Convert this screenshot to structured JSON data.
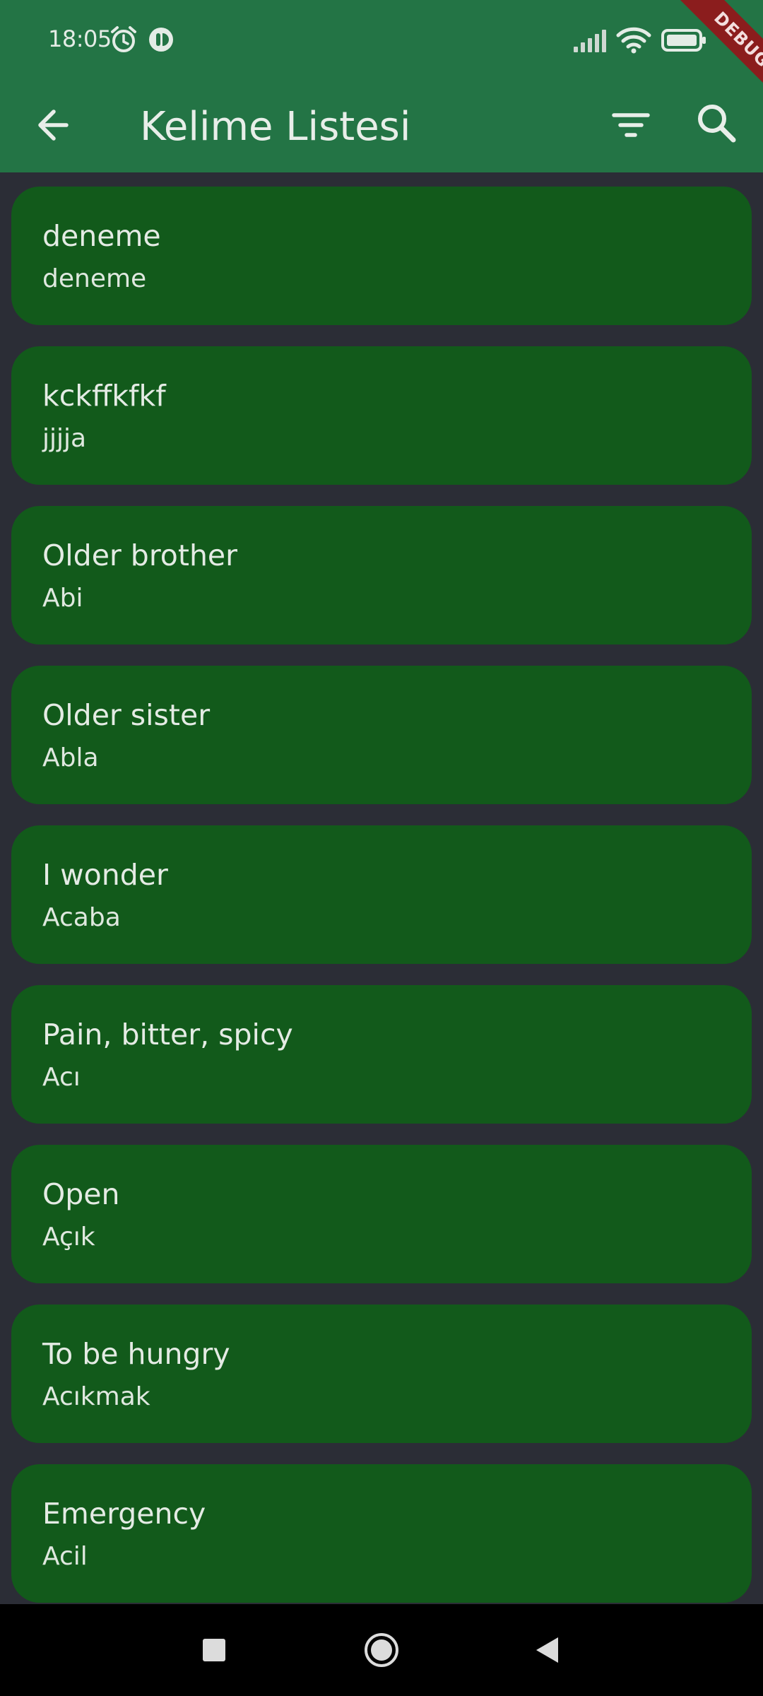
{
  "status_bar": {
    "time": "18:05",
    "icons": [
      "alarm-icon",
      "app-notification-icon",
      "signal-icon",
      "wifi-icon",
      "battery-icon"
    ]
  },
  "debug_banner": "DEBUG",
  "app_bar": {
    "title": "Kelime Listesi",
    "icons": [
      "back-arrow-icon",
      "filter-icon",
      "search-icon"
    ]
  },
  "words": [
    {
      "word": "deneme",
      "meaning": "deneme"
    },
    {
      "word": "kckffkfkf",
      "meaning": "jjjja"
    },
    {
      "word": "Older brother",
      "meaning": "Abi"
    },
    {
      "word": "Older sister",
      "meaning": "Abla"
    },
    {
      "word": "I wonder",
      "meaning": "Acaba"
    },
    {
      "word": "Pain, bitter, spicy",
      "meaning": "Acı"
    },
    {
      "word": "Open",
      "meaning": "Açık"
    },
    {
      "word": "To be hungry",
      "meaning": "Acıkmak"
    },
    {
      "word": "Emergency",
      "meaning": "Acil"
    }
  ],
  "nav_bar": {
    "icons": [
      "recents-square-icon",
      "home-circle-icon",
      "back-triangle-icon"
    ]
  },
  "colors": {
    "app_bar": "#237445",
    "card": "#125a1b",
    "background": "#2b2d36",
    "text": "#e4ebe4"
  }
}
